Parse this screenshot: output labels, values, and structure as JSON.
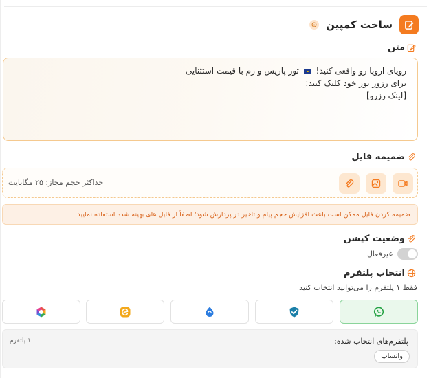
{
  "header": {
    "title": "ساخت کمپین",
    "info_icon": "info-icon",
    "icon": "edit-icon",
    "accent": "#f47b20"
  },
  "text_section": {
    "label": "متن",
    "icon": "pencil-icon",
    "lines": [
      "تور پاریس و رم با قیمت استثنایی",
      "رویای اروپا رو واقعی کنید!",
      "برای رزور تور خود کلیک کنید:",
      "[لینک رزرو]"
    ],
    "flag_icon": "eu-flag-icon"
  },
  "attachment": {
    "label": "ضمیمه فایل",
    "icon": "paperclip-icon",
    "max_size": "حداکثر حجم مجاز: ۲۵ مگابایت",
    "buttons": [
      "video-icon",
      "image-icon",
      "paperclip-icon"
    ]
  },
  "warning": {
    "text": "ضمیمه کردن فایل ممکن است باعث افزایش حجم پیام و تاخیر در پردازش شود؛ لطفاً از فایل های بهینه شده استفاده نمایید"
  },
  "caption": {
    "label": "وضعیت کپشن",
    "icon": "paperclip-icon",
    "toggle_state": "off",
    "toggle_label": "غیرفعال"
  },
  "platform": {
    "label": "انتخاب پلتفرم",
    "icon": "globe-icon",
    "hint": "فقط ۱ پلتفرم را می‌توانید انتخاب کنید",
    "options": [
      {
        "icon": "whatsapp-icon",
        "selected": true,
        "color": "#25a244"
      },
      {
        "icon": "shield-check-icon",
        "selected": false,
        "color": "#1a7fa8"
      },
      {
        "icon": "chat-drop-icon",
        "selected": false,
        "color": "#2d7de0"
      },
      {
        "icon": "eitaa-icon",
        "selected": false,
        "color": "#f3a81b"
      },
      {
        "icon": "rubika-icon",
        "selected": false,
        "color": "#e8524a"
      }
    ]
  },
  "selected_platforms": {
    "title": "پلتفرم‌های انتخاب شده:",
    "count": "۱ پلتفرم",
    "chips": [
      "واتساپ"
    ]
  }
}
